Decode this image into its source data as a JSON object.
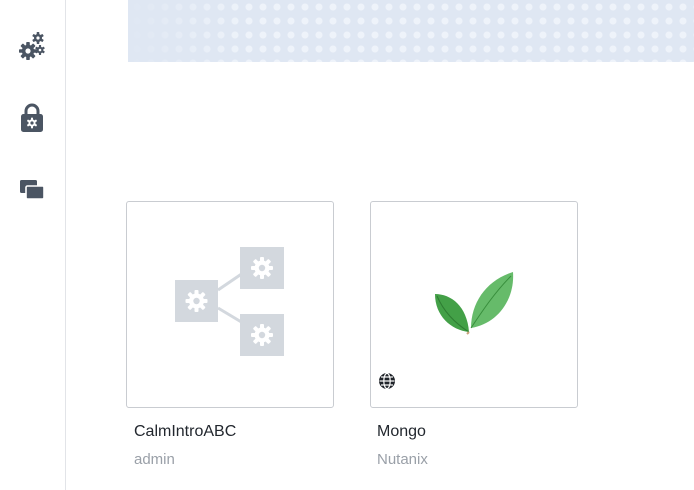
{
  "sidebar": {
    "items": [
      {
        "icon": "gears-icon"
      },
      {
        "icon": "lock-gear-icon"
      },
      {
        "icon": "projects-icon"
      }
    ]
  },
  "blueprints": [
    {
      "name": "CalmIntroABC",
      "owner": "admin",
      "icon": "multi-vm-blueprint-icon"
    },
    {
      "name": "Mongo",
      "owner": "Nutanix",
      "icon": "mongodb-leaf-icon",
      "badge": "globe-icon"
    }
  ],
  "colors": {
    "sidebar_icon": "#4b5563",
    "placeholder_icon": "#d3d8de",
    "leaf_green": "#4caf50"
  }
}
